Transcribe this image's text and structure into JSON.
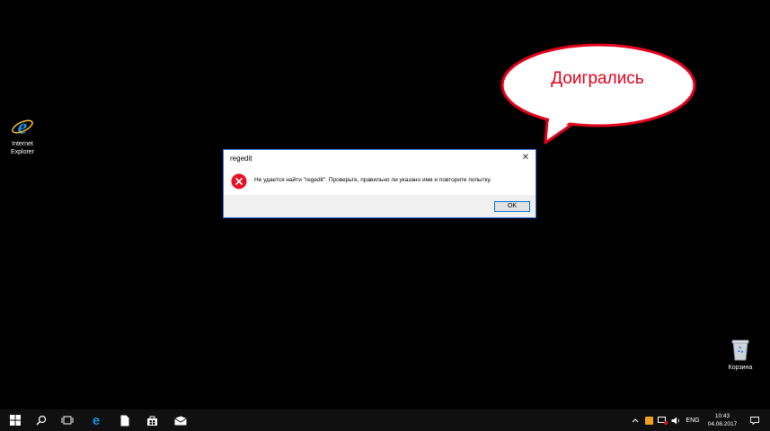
{
  "desktop": {
    "icons": [
      {
        "label_line1": "Internet",
        "label_line2": "Explorer"
      },
      {
        "label": "Корзина"
      }
    ]
  },
  "bubble": {
    "text": "Доигрались"
  },
  "dialog": {
    "title": "regedit",
    "close_glyph": "✕",
    "message": "Не удается найти \"regedit\". Проверьте, правильно ли указано имя и повторите попытку.",
    "ok_label": "OK",
    "icon": "error-icon"
  },
  "taskbar": {
    "buttons": [
      "start-icon",
      "search-icon",
      "task-view-icon",
      "edge-icon",
      "file-icon",
      "store-icon",
      "mail-icon"
    ],
    "tray": {
      "chevron": "^",
      "language": "ENG",
      "time": "10:43",
      "date": "04.08.2017"
    }
  },
  "colors": {
    "desktop_bg": "#000000",
    "taskbar_bg": "#101010",
    "bubble_text": "#e3001b",
    "dialog_border": "#2b6fd6",
    "error_red": "#e81123"
  }
}
